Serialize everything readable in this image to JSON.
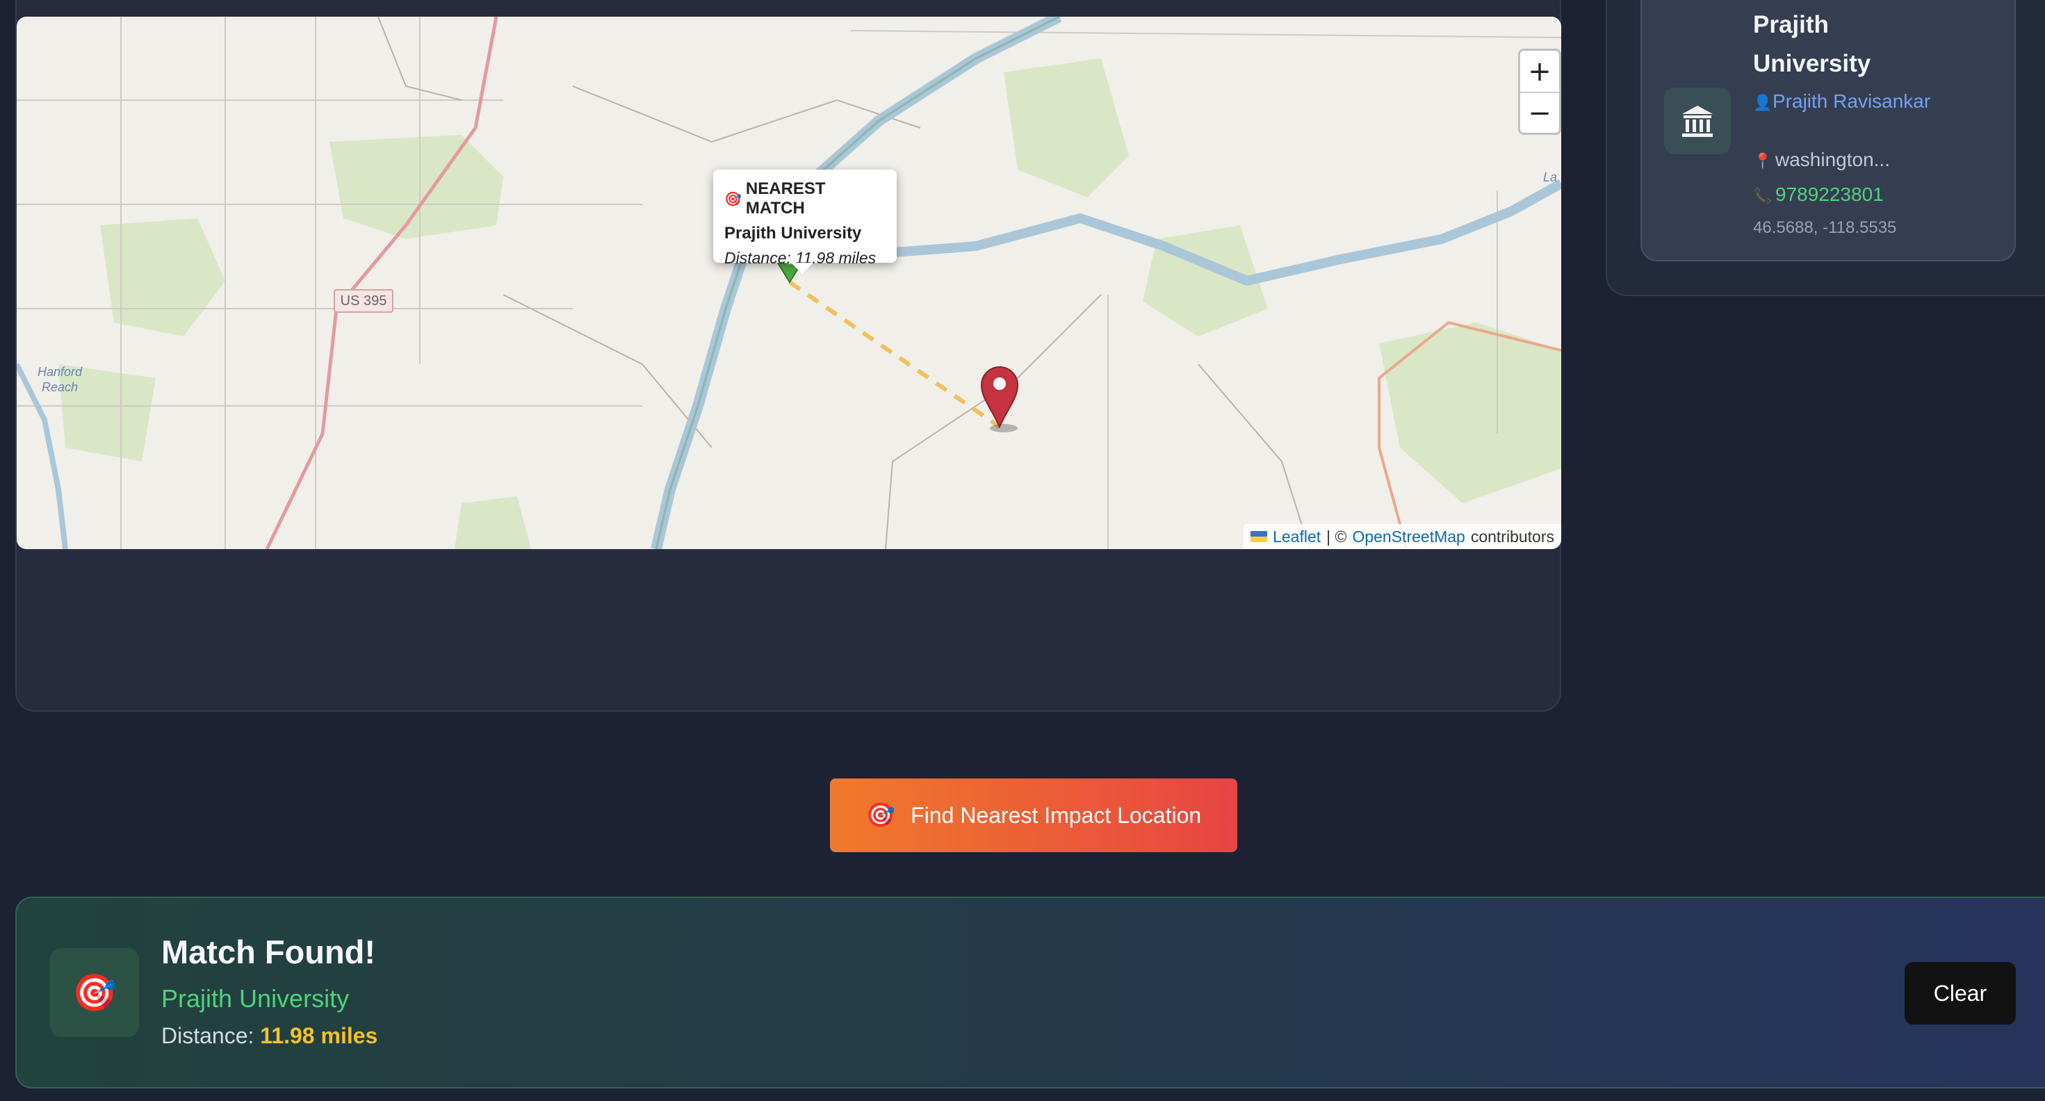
{
  "map": {
    "zoom_in_label": "+",
    "zoom_out_label": "−",
    "road_shield": "US 395",
    "place_label": "Hanford\nReach",
    "side_label": "La",
    "popup": {
      "header": "NEAREST MATCH",
      "name": "Prajith University",
      "distance": "Distance: 11.98 miles"
    },
    "attribution": {
      "leaflet": "Leaflet",
      "separator": "| ©",
      "osm": "OpenStreetMap",
      "suffix": "contributors"
    },
    "marker_colors": {
      "match": "#4ea83f",
      "query": "#c4333f",
      "route": "#f0c05a"
    }
  },
  "side_card": {
    "title": "Prajith University",
    "owner": "Prajith Ravisankar",
    "address": "washington...",
    "phone": "9789223801",
    "coords": "46.5688, -118.5535",
    "icons": {
      "main": "museum-icon",
      "owner": "person-icon",
      "address": "pin-icon",
      "phone": "phone-icon"
    }
  },
  "actions": {
    "find_label": "Find Nearest Impact Location",
    "find_icon": "target-dart-icon"
  },
  "match": {
    "title": "Match Found!",
    "name": "Prajith University",
    "distance_prefix": "Distance:",
    "distance_value": "11.98 miles",
    "clear_label": "Clear",
    "icon": "target-dart-icon"
  },
  "colors": {
    "background": "#1c2233",
    "accent_orange": "#f07a2b",
    "accent_red": "#e64544",
    "success_green": "#4fd37b",
    "distance_yellow": "#f5c02a",
    "link_blue": "#6fa3f5"
  }
}
